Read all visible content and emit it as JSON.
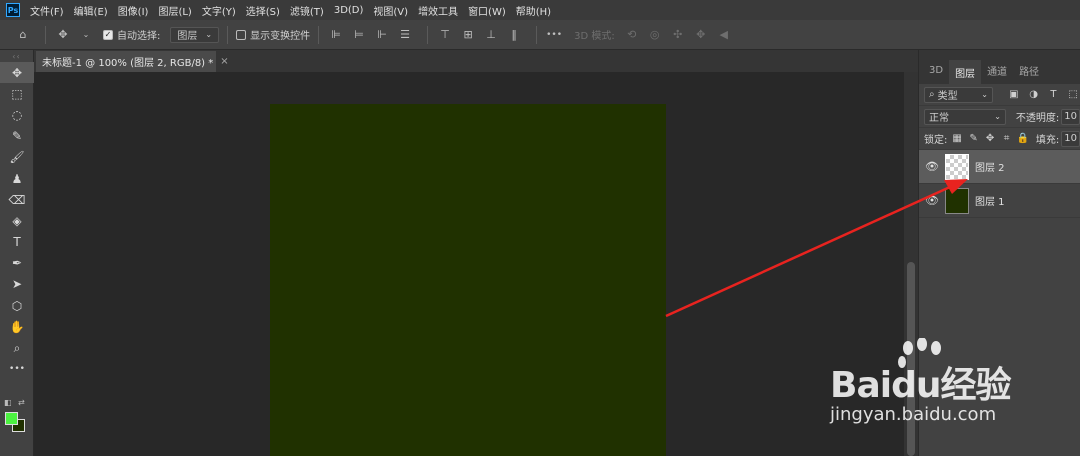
{
  "app": {
    "logo": "Ps"
  },
  "menu": [
    "文件(F)",
    "编辑(E)",
    "图像(I)",
    "图层(L)",
    "文字(Y)",
    "选择(S)",
    "滤镜(T)",
    "3D(D)",
    "视图(V)",
    "增效工具",
    "窗口(W)",
    "帮助(H)"
  ],
  "options": {
    "auto_select_label": "自动选择:",
    "auto_select_value": "图层",
    "show_transform_label": "显示变换控件",
    "mode_3d_label": "3D 模式:",
    "more": "•••"
  },
  "document": {
    "tab_title": "未标题-1 @ 100% (图层 2, RGB/8) *",
    "close": "×"
  },
  "panel": {
    "tabs": [
      "3D",
      "图层",
      "通道",
      "路径"
    ],
    "active_tab": "图层",
    "filter_label": "类型",
    "blend_mode": "正常",
    "opacity_label": "不透明度:",
    "opacity_value": "10",
    "lock_label": "锁定:",
    "fill_label": "填充:",
    "fill_value": "10",
    "layers": [
      {
        "name": "图层 2",
        "selected": true,
        "thumb": "transparent"
      },
      {
        "name": "图层 1",
        "selected": false,
        "thumb": "filled"
      }
    ]
  },
  "colors": {
    "foreground": "#4cf241",
    "background": "#203100",
    "canvas_fill": "#203100",
    "arrow": "#e8231f"
  },
  "watermark": {
    "brand": "Baidu经验",
    "url": "jingyan.baidu.com"
  }
}
